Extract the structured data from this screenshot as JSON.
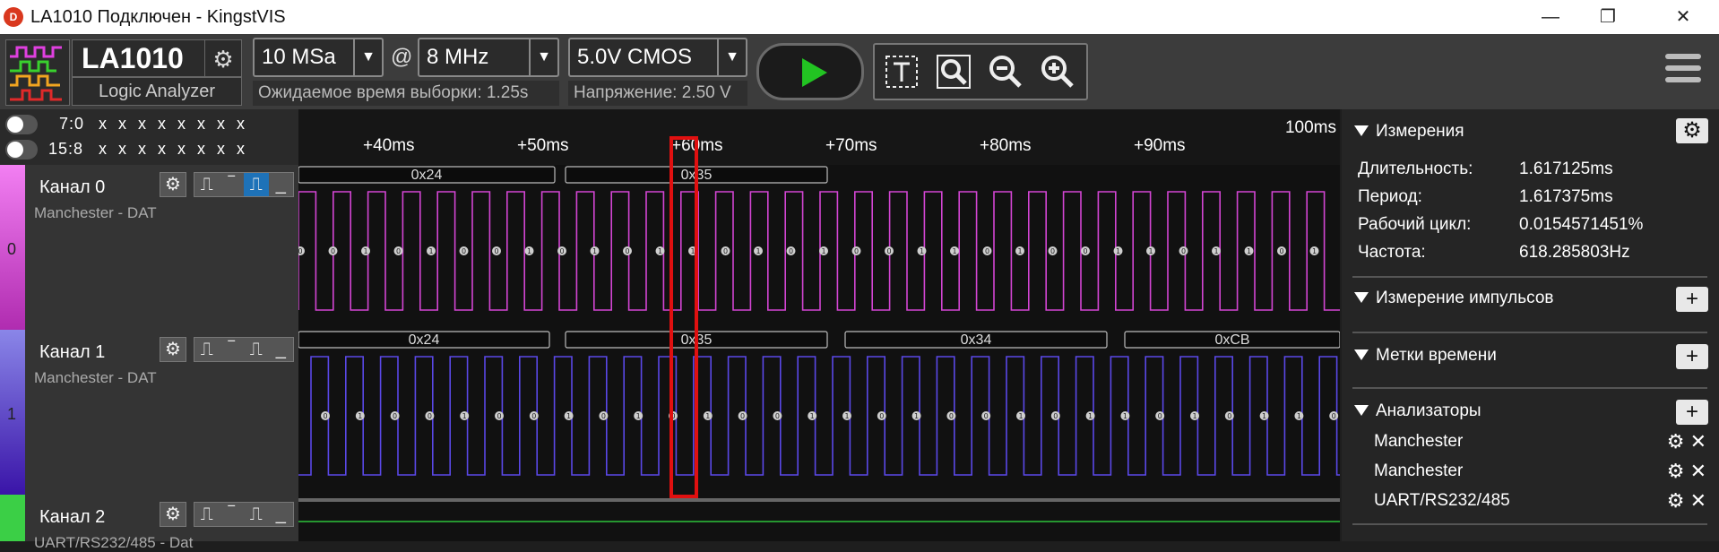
{
  "window": {
    "app_icon_text": "D",
    "title": "LA1010 Подключен - KingstVIS",
    "minimize": "—",
    "maximize": "❐",
    "close": "✕"
  },
  "toolbar": {
    "device_name": "LA1010",
    "device_sub": "Logic Analyzer",
    "sample_rate": "10 MSa",
    "at_symbol": "@",
    "frequency": "8 MHz",
    "voltage_std": "5.0V CMOS",
    "expected_time": "Ожидаемое время выборки: 1.25s",
    "threshold": "Напряжение: 2.50 V",
    "tool_icons": [
      "text-cursor-icon",
      "zoom-fit-icon",
      "zoom-out-icon",
      "zoom-in-icon"
    ]
  },
  "channel_header": {
    "row1_label": "7:0",
    "row1_bits": "x  x  x  x  x  x  x  x",
    "row2_label": "15:8",
    "row2_bits": "x  x  x  x  x  x  x  x"
  },
  "ruler": {
    "ticks": [
      "+40ms",
      "+50ms",
      "+60ms",
      "+70ms",
      "+80ms",
      "+90ms"
    ],
    "top_label": "100ms"
  },
  "channels": [
    {
      "name": "Канал 0",
      "protocol": "Manchester - DAT",
      "index": "0",
      "color": "#e05ce0",
      "wave_color": "#d445d4"
    },
    {
      "name": "Канал 1",
      "protocol": "Manchester - DAT",
      "index": "1",
      "color": "#6b4fe0",
      "wave_color": "#5a48e8"
    },
    {
      "name": "Канал 2",
      "protocol": "UART/RS232/485 - Dat",
      "index": "2",
      "color": "#34c23e",
      "wave_color": "#2ec43a"
    }
  ],
  "decodes": {
    "ch0": [
      "0x24",
      "0x35"
    ],
    "ch1": [
      "0x24",
      "0x35",
      "0x34",
      "0xCB"
    ]
  },
  "bit_labels": {
    "ch0": "0 0 1 0 1 0 0 1 0 1 0 1 1 0 1 0 1 0 0 1 1 0 1 0 0 1 1 0 1 1 0 1",
    "ch1": "0 1 0 0 1 0 0 1 0 1 0 1 0 0 1 1 0 1 0 0 1 0 1 1 0 1 0 1 1 0"
  },
  "panel": {
    "measurements": {
      "title": "Измерения",
      "rows": [
        {
          "label": "Длительность:",
          "value": "1.617125ms"
        },
        {
          "label": "Период:",
          "value": "1.617375ms"
        },
        {
          "label": "Рабочий цикл:",
          "value": "0.0154571451%"
        },
        {
          "label": "Частота:",
          "value": "618.285803Hz"
        }
      ]
    },
    "pulse_measure": "Измерение импульсов",
    "time_marks": "Метки времени",
    "analyzers": {
      "title": "Анализаторы",
      "items": [
        "Manchester",
        "Manchester",
        "UART/RS232/485"
      ]
    },
    "add_label": "+"
  },
  "highlight_color": "#e01010"
}
